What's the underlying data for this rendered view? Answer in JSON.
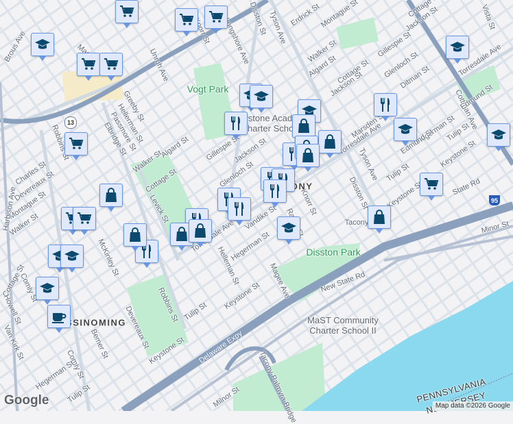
{
  "colors": {
    "land": "#f3f2f4",
    "water": "#8ad9ef",
    "park": "#c2ecd1",
    "highway": "#8aa0bd",
    "arterial": "#cfd9e4",
    "marker_bg": "#dfe9fb",
    "marker_border": "#6a97e2",
    "icon": "#0b4a6e"
  },
  "labels": [
    "Brous Ave",
    "Tyson Ave",
    "Disston St",
    "Erdrick St",
    "Montague St",
    "Walker St",
    "Algard St",
    "Cottage St",
    "Gillespie St",
    "Jackson St",
    "Cottage St",
    "Vista St",
    "Glenloch St",
    "Ditman St",
    "Torresdale Ave",
    "Cottman Ave",
    "Edmund St",
    "Jackson St",
    "Marsden St",
    "Torresdale Ave",
    "Hegerman St",
    "Edmund St",
    "Tulip St",
    "Keystone St",
    "Tulip St",
    "Keystone St",
    "Tyson Ave",
    "Disston St",
    "Knorr St",
    "State Rd",
    "Minor St",
    "Tacony",
    "New State Rd",
    "Magee Ave",
    "Keystone St",
    "Hegerman St",
    "Vandike St",
    "Torresdale Ave",
    "Helleman St",
    "Glenloch St",
    "Gillespie St",
    "Jackson St",
    "Algard St",
    "Walker St",
    "Cottage St",
    "Levick St",
    "Unruh Ave",
    "Knorr St",
    "Longshore Ave",
    "Magee Ave",
    "Greeby St",
    "Hellerman St",
    "Passmore St",
    "Elbridge St",
    "Robbins St",
    "Charles St",
    "Devereaux St",
    "Montague St",
    "Walker St",
    "Harbison Ave",
    "McKinley St",
    "Robbins St",
    "Tulip St",
    "Devereaux St",
    "Keystone St",
    "Bemer St",
    "Comly St",
    "Hegerman St",
    "Tulip St",
    "Milnor St",
    "Tacony-Palmyra Bridge",
    "Cottage St",
    "Comly St",
    "Howell St",
    "Van Kirk St",
    "Rawle St"
  ],
  "green_labels": [
    "Vogt Park",
    "Disston Park"
  ],
  "poi_labels": [
    "Keystone Academy\nCharter School",
    "MaST Community\nCharter School II"
  ],
  "hood_labels": [
    "TACONY",
    "SSINOMING"
  ],
  "road_labels": [
    "Delaware Expy"
  ],
  "state_labels": [
    "PENNSYLVANIA",
    "NEW JERSEY"
  ],
  "shields": [
    "13",
    "95"
  ],
  "markers": [
    "cart",
    "cart",
    "cart",
    "cart",
    "cart",
    "cart",
    "cart",
    "cart",
    "cart",
    "grad-cap",
    "grad-cap",
    "grad-cap",
    "grad-cap",
    "grad-cap",
    "grad-cap",
    "grad-cap",
    "grad-cap",
    "grad-cap",
    "grad-cap",
    "grad-cap",
    "fork-knife",
    "fork-knife",
    "fork-knife",
    "fork-knife",
    "fork-knife",
    "fork-knife",
    "fork-knife",
    "fork-knife",
    "fork-knife",
    "fork-knife",
    "bag",
    "bag",
    "bag",
    "bag",
    "bag",
    "bag",
    "bag",
    "bag",
    "bag",
    "coffee"
  ],
  "logo": "Google",
  "attribution": "Map data ©2026 Google"
}
